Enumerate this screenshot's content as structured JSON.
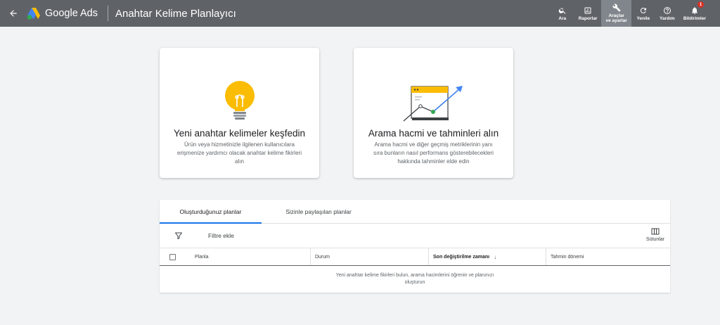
{
  "header": {
    "brand": "Google Ads",
    "page_title": "Anahtar Kelime Planlayıcı",
    "actions": [
      {
        "label": "Ara",
        "icon": "search-icon"
      },
      {
        "label": "Raporlar",
        "icon": "reports-icon"
      },
      {
        "label": "Araçlar\nve ayarlar",
        "icon": "tools-icon",
        "active": true
      },
      {
        "label": "Yenile",
        "icon": "refresh-icon"
      },
      {
        "label": "Yardım",
        "icon": "help-icon"
      },
      {
        "label": "Bildirimler",
        "icon": "bell-icon",
        "badge": "1"
      }
    ]
  },
  "cards": [
    {
      "title": "Yeni anahtar kelimeler keşfedin",
      "description": "Ürün veya hizmetinizle ilgilenen kullanıcılara erişmenize yardımcı olacak anahtar kelime fikirleri alın",
      "icon": "lightbulb-icon"
    },
    {
      "title": "Arama hacmi ve tahminleri alın",
      "description": "Arama hacmi ve diğer geçmiş metriklerinin yanı sıra bunların nasıl performans gösterebilecekleri hakkında tahminler elde edin",
      "icon": "trend-chart-icon"
    }
  ],
  "plans": {
    "tabs": [
      "Oluşturduğunuz planlar",
      "Sizinle paylaşılan planlar"
    ],
    "active_tab": 0,
    "filter_label": "Filtre ekle",
    "columns_label": "Sütunlar",
    "headers": {
      "plan": "Planla",
      "status": "Durum",
      "modified": "Son değiştirilme zamanı",
      "period": "Tahmin dönemi"
    },
    "empty_line1": "Yeni anahtar kelime fikirleri bulun, arama hacimlerini öğrenin ve planınızı",
    "empty_line2": "oluşturun"
  },
  "colors": {
    "topbar": "#5f6368",
    "accent": "#1a73e8",
    "bulb": "#fbbc04",
    "badge": "#d93025"
  }
}
